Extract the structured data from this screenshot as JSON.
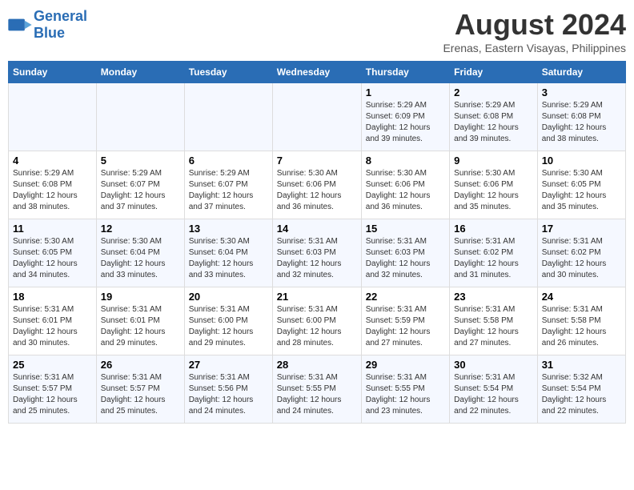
{
  "header": {
    "logo_text_general": "General",
    "logo_text_blue": "Blue",
    "month_year": "August 2024",
    "location": "Erenas, Eastern Visayas, Philippines"
  },
  "days_of_week": [
    "Sunday",
    "Monday",
    "Tuesday",
    "Wednesday",
    "Thursday",
    "Friday",
    "Saturday"
  ],
  "weeks": [
    [
      {
        "day": "",
        "info": ""
      },
      {
        "day": "",
        "info": ""
      },
      {
        "day": "",
        "info": ""
      },
      {
        "day": "",
        "info": ""
      },
      {
        "day": "1",
        "info": "Sunrise: 5:29 AM\nSunset: 6:09 PM\nDaylight: 12 hours and 39 minutes."
      },
      {
        "day": "2",
        "info": "Sunrise: 5:29 AM\nSunset: 6:08 PM\nDaylight: 12 hours and 39 minutes."
      },
      {
        "day": "3",
        "info": "Sunrise: 5:29 AM\nSunset: 6:08 PM\nDaylight: 12 hours and 38 minutes."
      }
    ],
    [
      {
        "day": "4",
        "info": "Sunrise: 5:29 AM\nSunset: 6:08 PM\nDaylight: 12 hours and 38 minutes."
      },
      {
        "day": "5",
        "info": "Sunrise: 5:29 AM\nSunset: 6:07 PM\nDaylight: 12 hours and 37 minutes."
      },
      {
        "day": "6",
        "info": "Sunrise: 5:29 AM\nSunset: 6:07 PM\nDaylight: 12 hours and 37 minutes."
      },
      {
        "day": "7",
        "info": "Sunrise: 5:30 AM\nSunset: 6:06 PM\nDaylight: 12 hours and 36 minutes."
      },
      {
        "day": "8",
        "info": "Sunrise: 5:30 AM\nSunset: 6:06 PM\nDaylight: 12 hours and 36 minutes."
      },
      {
        "day": "9",
        "info": "Sunrise: 5:30 AM\nSunset: 6:06 PM\nDaylight: 12 hours and 35 minutes."
      },
      {
        "day": "10",
        "info": "Sunrise: 5:30 AM\nSunset: 6:05 PM\nDaylight: 12 hours and 35 minutes."
      }
    ],
    [
      {
        "day": "11",
        "info": "Sunrise: 5:30 AM\nSunset: 6:05 PM\nDaylight: 12 hours and 34 minutes."
      },
      {
        "day": "12",
        "info": "Sunrise: 5:30 AM\nSunset: 6:04 PM\nDaylight: 12 hours and 33 minutes."
      },
      {
        "day": "13",
        "info": "Sunrise: 5:30 AM\nSunset: 6:04 PM\nDaylight: 12 hours and 33 minutes."
      },
      {
        "day": "14",
        "info": "Sunrise: 5:31 AM\nSunset: 6:03 PM\nDaylight: 12 hours and 32 minutes."
      },
      {
        "day": "15",
        "info": "Sunrise: 5:31 AM\nSunset: 6:03 PM\nDaylight: 12 hours and 32 minutes."
      },
      {
        "day": "16",
        "info": "Sunrise: 5:31 AM\nSunset: 6:02 PM\nDaylight: 12 hours and 31 minutes."
      },
      {
        "day": "17",
        "info": "Sunrise: 5:31 AM\nSunset: 6:02 PM\nDaylight: 12 hours and 30 minutes."
      }
    ],
    [
      {
        "day": "18",
        "info": "Sunrise: 5:31 AM\nSunset: 6:01 PM\nDaylight: 12 hours and 30 minutes."
      },
      {
        "day": "19",
        "info": "Sunrise: 5:31 AM\nSunset: 6:01 PM\nDaylight: 12 hours and 29 minutes."
      },
      {
        "day": "20",
        "info": "Sunrise: 5:31 AM\nSunset: 6:00 PM\nDaylight: 12 hours and 29 minutes."
      },
      {
        "day": "21",
        "info": "Sunrise: 5:31 AM\nSunset: 6:00 PM\nDaylight: 12 hours and 28 minutes."
      },
      {
        "day": "22",
        "info": "Sunrise: 5:31 AM\nSunset: 5:59 PM\nDaylight: 12 hours and 27 minutes."
      },
      {
        "day": "23",
        "info": "Sunrise: 5:31 AM\nSunset: 5:58 PM\nDaylight: 12 hours and 27 minutes."
      },
      {
        "day": "24",
        "info": "Sunrise: 5:31 AM\nSunset: 5:58 PM\nDaylight: 12 hours and 26 minutes."
      }
    ],
    [
      {
        "day": "25",
        "info": "Sunrise: 5:31 AM\nSunset: 5:57 PM\nDaylight: 12 hours and 25 minutes."
      },
      {
        "day": "26",
        "info": "Sunrise: 5:31 AM\nSunset: 5:57 PM\nDaylight: 12 hours and 25 minutes."
      },
      {
        "day": "27",
        "info": "Sunrise: 5:31 AM\nSunset: 5:56 PM\nDaylight: 12 hours and 24 minutes."
      },
      {
        "day": "28",
        "info": "Sunrise: 5:31 AM\nSunset: 5:55 PM\nDaylight: 12 hours and 24 minutes."
      },
      {
        "day": "29",
        "info": "Sunrise: 5:31 AM\nSunset: 5:55 PM\nDaylight: 12 hours and 23 minutes."
      },
      {
        "day": "30",
        "info": "Sunrise: 5:31 AM\nSunset: 5:54 PM\nDaylight: 12 hours and 22 minutes."
      },
      {
        "day": "31",
        "info": "Sunrise: 5:32 AM\nSunset: 5:54 PM\nDaylight: 12 hours and 22 minutes."
      }
    ]
  ]
}
